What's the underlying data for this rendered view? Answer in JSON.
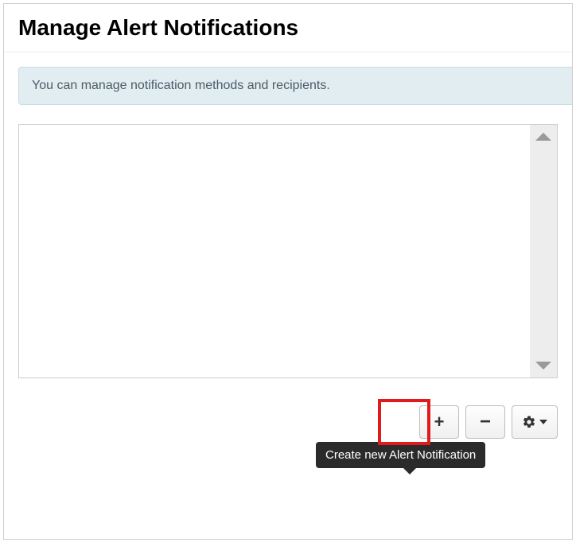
{
  "header": {
    "title": "Manage Alert Notifications"
  },
  "info": {
    "text": "You can manage notification methods and recipients."
  },
  "tooltip": {
    "text": "Create new Alert Notification"
  },
  "buttons": {
    "add_glyph": "+",
    "remove_glyph": "−"
  }
}
